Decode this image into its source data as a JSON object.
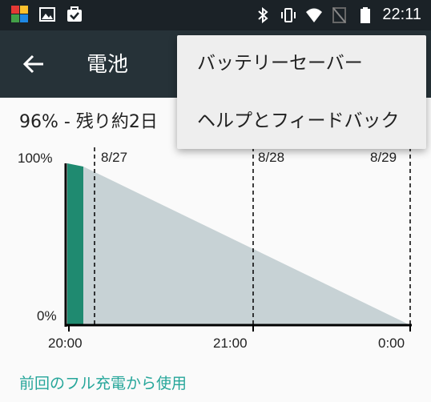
{
  "app": {
    "title": "電池"
  },
  "status_bar": {
    "time": "22:11"
  },
  "summary": "96% - 残り約2日",
  "overflow_menu": {
    "items": [
      {
        "label": "バッテリーセーバー"
      },
      {
        "label": "ヘルプとフィードバック"
      }
    ]
  },
  "chart_data": {
    "type": "area",
    "y_ticks": [
      "100%",
      "0%"
    ],
    "x_ticks": [
      "20:00",
      "21:00",
      "0:00"
    ],
    "date_markers": [
      "8/27",
      "8/28",
      "8/29"
    ],
    "series": [
      {
        "kind": "actual",
        "color": "#1f8a70",
        "points": [
          [
            0,
            97
          ],
          [
            0.04,
            95
          ]
        ]
      },
      {
        "kind": "projection",
        "color": "#c7d2d5",
        "points": [
          [
            0.04,
            95
          ],
          [
            1,
            0
          ]
        ]
      }
    ],
    "ylim": [
      0,
      100
    ]
  },
  "footer": {
    "link": "前回のフル充電から使用"
  },
  "colors": {
    "status_bar": "#1b2227",
    "app_bar": "#263238",
    "accent": "#26a69a"
  }
}
